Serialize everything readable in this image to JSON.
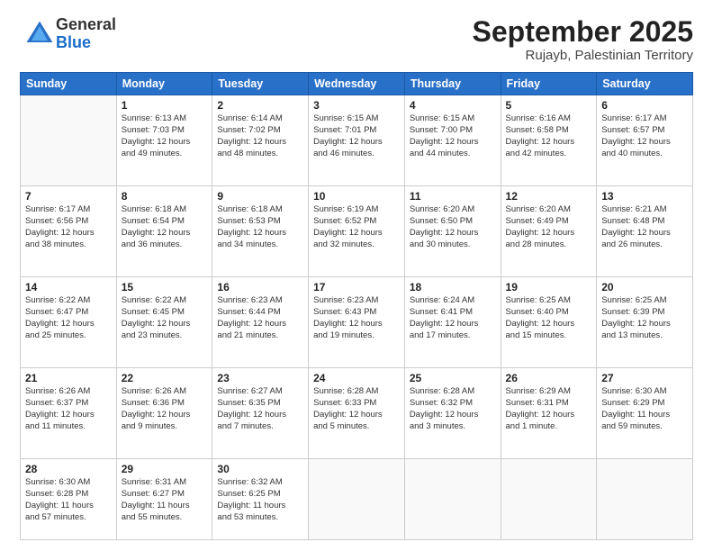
{
  "logo": {
    "general": "General",
    "blue": "Blue"
  },
  "title": {
    "month": "September 2025",
    "location": "Rujayb, Palestinian Territory"
  },
  "weekdays": [
    "Sunday",
    "Monday",
    "Tuesday",
    "Wednesday",
    "Thursday",
    "Friday",
    "Saturday"
  ],
  "weeks": [
    [
      {
        "day": "",
        "info": ""
      },
      {
        "day": "1",
        "info": "Sunrise: 6:13 AM\nSunset: 7:03 PM\nDaylight: 12 hours\nand 49 minutes."
      },
      {
        "day": "2",
        "info": "Sunrise: 6:14 AM\nSunset: 7:02 PM\nDaylight: 12 hours\nand 48 minutes."
      },
      {
        "day": "3",
        "info": "Sunrise: 6:15 AM\nSunset: 7:01 PM\nDaylight: 12 hours\nand 46 minutes."
      },
      {
        "day": "4",
        "info": "Sunrise: 6:15 AM\nSunset: 7:00 PM\nDaylight: 12 hours\nand 44 minutes."
      },
      {
        "day": "5",
        "info": "Sunrise: 6:16 AM\nSunset: 6:58 PM\nDaylight: 12 hours\nand 42 minutes."
      },
      {
        "day": "6",
        "info": "Sunrise: 6:17 AM\nSunset: 6:57 PM\nDaylight: 12 hours\nand 40 minutes."
      }
    ],
    [
      {
        "day": "7",
        "info": "Sunrise: 6:17 AM\nSunset: 6:56 PM\nDaylight: 12 hours\nand 38 minutes."
      },
      {
        "day": "8",
        "info": "Sunrise: 6:18 AM\nSunset: 6:54 PM\nDaylight: 12 hours\nand 36 minutes."
      },
      {
        "day": "9",
        "info": "Sunrise: 6:18 AM\nSunset: 6:53 PM\nDaylight: 12 hours\nand 34 minutes."
      },
      {
        "day": "10",
        "info": "Sunrise: 6:19 AM\nSunset: 6:52 PM\nDaylight: 12 hours\nand 32 minutes."
      },
      {
        "day": "11",
        "info": "Sunrise: 6:20 AM\nSunset: 6:50 PM\nDaylight: 12 hours\nand 30 minutes."
      },
      {
        "day": "12",
        "info": "Sunrise: 6:20 AM\nSunset: 6:49 PM\nDaylight: 12 hours\nand 28 minutes."
      },
      {
        "day": "13",
        "info": "Sunrise: 6:21 AM\nSunset: 6:48 PM\nDaylight: 12 hours\nand 26 minutes."
      }
    ],
    [
      {
        "day": "14",
        "info": "Sunrise: 6:22 AM\nSunset: 6:47 PM\nDaylight: 12 hours\nand 25 minutes."
      },
      {
        "day": "15",
        "info": "Sunrise: 6:22 AM\nSunset: 6:45 PM\nDaylight: 12 hours\nand 23 minutes."
      },
      {
        "day": "16",
        "info": "Sunrise: 6:23 AM\nSunset: 6:44 PM\nDaylight: 12 hours\nand 21 minutes."
      },
      {
        "day": "17",
        "info": "Sunrise: 6:23 AM\nSunset: 6:43 PM\nDaylight: 12 hours\nand 19 minutes."
      },
      {
        "day": "18",
        "info": "Sunrise: 6:24 AM\nSunset: 6:41 PM\nDaylight: 12 hours\nand 17 minutes."
      },
      {
        "day": "19",
        "info": "Sunrise: 6:25 AM\nSunset: 6:40 PM\nDaylight: 12 hours\nand 15 minutes."
      },
      {
        "day": "20",
        "info": "Sunrise: 6:25 AM\nSunset: 6:39 PM\nDaylight: 12 hours\nand 13 minutes."
      }
    ],
    [
      {
        "day": "21",
        "info": "Sunrise: 6:26 AM\nSunset: 6:37 PM\nDaylight: 12 hours\nand 11 minutes."
      },
      {
        "day": "22",
        "info": "Sunrise: 6:26 AM\nSunset: 6:36 PM\nDaylight: 12 hours\nand 9 minutes."
      },
      {
        "day": "23",
        "info": "Sunrise: 6:27 AM\nSunset: 6:35 PM\nDaylight: 12 hours\nand 7 minutes."
      },
      {
        "day": "24",
        "info": "Sunrise: 6:28 AM\nSunset: 6:33 PM\nDaylight: 12 hours\nand 5 minutes."
      },
      {
        "day": "25",
        "info": "Sunrise: 6:28 AM\nSunset: 6:32 PM\nDaylight: 12 hours\nand 3 minutes."
      },
      {
        "day": "26",
        "info": "Sunrise: 6:29 AM\nSunset: 6:31 PM\nDaylight: 12 hours\nand 1 minute."
      },
      {
        "day": "27",
        "info": "Sunrise: 6:30 AM\nSunset: 6:29 PM\nDaylight: 11 hours\nand 59 minutes."
      }
    ],
    [
      {
        "day": "28",
        "info": "Sunrise: 6:30 AM\nSunset: 6:28 PM\nDaylight: 11 hours\nand 57 minutes."
      },
      {
        "day": "29",
        "info": "Sunrise: 6:31 AM\nSunset: 6:27 PM\nDaylight: 11 hours\nand 55 minutes."
      },
      {
        "day": "30",
        "info": "Sunrise: 6:32 AM\nSunset: 6:25 PM\nDaylight: 11 hours\nand 53 minutes."
      },
      {
        "day": "",
        "info": ""
      },
      {
        "day": "",
        "info": ""
      },
      {
        "day": "",
        "info": ""
      },
      {
        "day": "",
        "info": ""
      }
    ]
  ]
}
